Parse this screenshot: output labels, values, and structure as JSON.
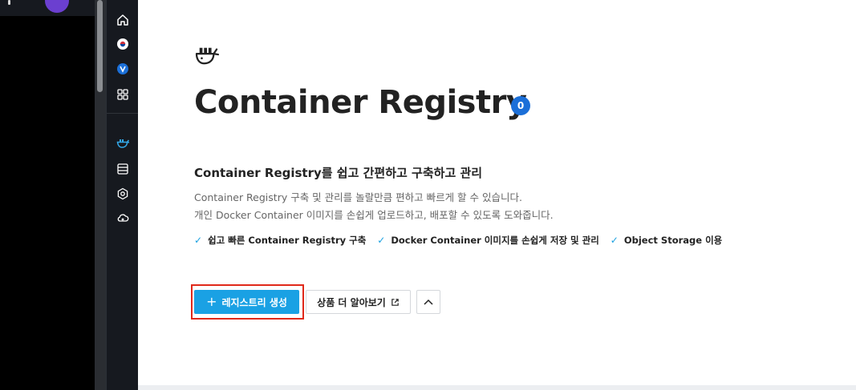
{
  "colors": {
    "accent": "#1aa1e4",
    "badge": "#1b6fd8",
    "check": "#19a0e0",
    "highlight": "#e0291a",
    "rail_bg": "#16191f"
  },
  "rail": {
    "items": [
      {
        "icon": "home-icon"
      },
      {
        "icon": "korea-flag-icon"
      },
      {
        "icon": "v-badge-icon"
      },
      {
        "icon": "apps-grid-icon"
      },
      {
        "icon": "container-registry-icon",
        "active": true
      },
      {
        "icon": "storage-icon"
      },
      {
        "icon": "hexagon-settings-icon"
      },
      {
        "icon": "cloud-network-icon"
      }
    ]
  },
  "hero": {
    "title": "Container Registry",
    "count": "0",
    "subtitle": "Container Registry를 쉽고 간편하고 구축하고 관리",
    "description_lines": [
      "Container Registry 구축 및 관리를 놀랄만큼 편하고 빠르게 할 수 있습니다.",
      "개인 Docker Container 이미지를 손쉽게 업로드하고, 배포할 수 있도록 도와줍니다."
    ],
    "features": [
      "쉽고 빠른 Container Registry 구축",
      "Docker Container 이미지를 손쉽게 저장 및 관리",
      "Object Storage 이용"
    ]
  },
  "actions": {
    "create_label": "레지스트리 생성",
    "create_icon": "+",
    "learn_label": "상품 더 알아보기"
  }
}
